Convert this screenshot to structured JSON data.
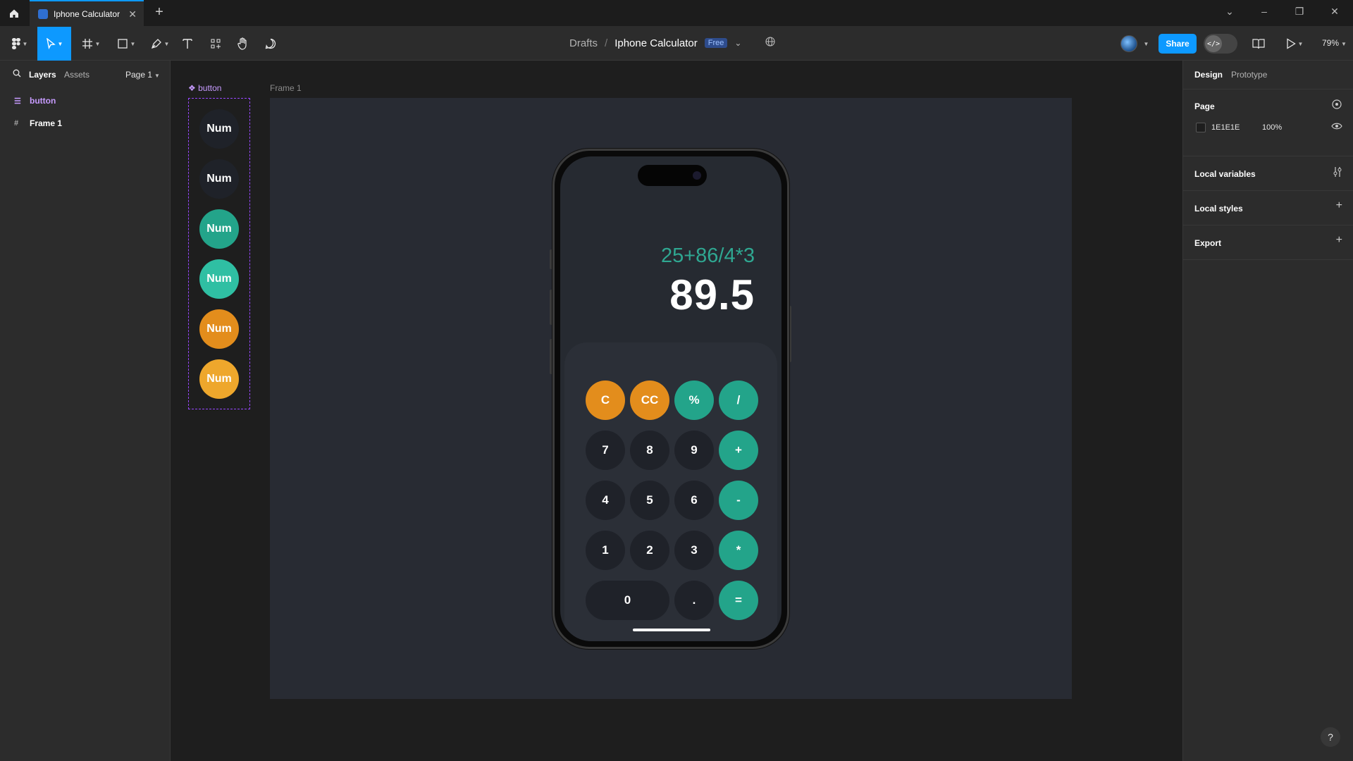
{
  "tab": {
    "title": "Iphone Calculator"
  },
  "toolbar": {
    "breadcrumb_parent": "Drafts",
    "breadcrumb_sep": "/",
    "file_title": "Iphone Calculator",
    "plan_badge": "Free",
    "share_label": "Share",
    "zoom": "79%",
    "caret": "⌄"
  },
  "left_panel": {
    "tabs": {
      "layers": "Layers",
      "assets": "Assets",
      "page": "Page 1"
    },
    "layers": [
      {
        "name": "button",
        "kind": "component"
      },
      {
        "name": "Frame 1",
        "kind": "frame"
      }
    ]
  },
  "canvas": {
    "component_label": "button",
    "frame_label": "Frame 1",
    "variants": [
      {
        "label": "Num",
        "color": "#1f2229"
      },
      {
        "label": "Num",
        "color": "#1f2229"
      },
      {
        "label": "Num",
        "color": "#23a48a"
      },
      {
        "label": "Num",
        "color": "#2fbfa3"
      },
      {
        "label": "Num",
        "color": "#e38d1c"
      },
      {
        "label": "Num",
        "color": "#eea72c"
      }
    ],
    "calculator": {
      "expression": "25+86/4*3",
      "result": "89.5",
      "keys": {
        "c": "C",
        "cc": "CC",
        "percent": "%",
        "divide": "/",
        "k7": "7",
        "k8": "8",
        "k9": "9",
        "plus": "+",
        "k4": "4",
        "k5": "5",
        "k6": "6",
        "minus": "-",
        "k1": "1",
        "k2": "2",
        "k3": "3",
        "multiply": "*",
        "k0": "0",
        "dot": ".",
        "equals": "="
      }
    }
  },
  "right_panel": {
    "tabs": {
      "design": "Design",
      "prototype": "Prototype"
    },
    "page_title": "Page",
    "page_color": "1E1E1E",
    "page_opacity": "100%",
    "local_variables": "Local variables",
    "local_styles": "Local styles",
    "export": "Export"
  },
  "help": "?",
  "colors": {
    "accent": "#0d99ff",
    "orange": "#e38d1c",
    "teal": "#23a48a",
    "component": "#9747ff"
  }
}
